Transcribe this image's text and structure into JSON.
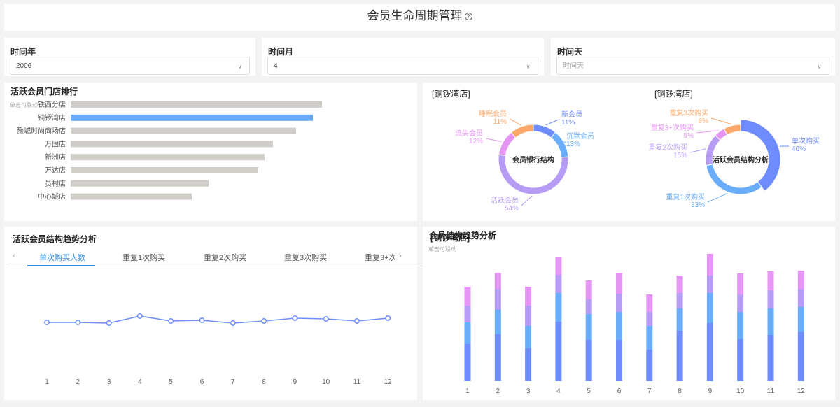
{
  "header": {
    "title": "会员生命周期管理",
    "help_icon": "question-circle-icon"
  },
  "filters": [
    {
      "label": "时间年",
      "value": "2006",
      "placeholder": ""
    },
    {
      "label": "时间月",
      "value": "4",
      "placeholder": ""
    },
    {
      "label": "时间天",
      "value": "",
      "placeholder": "时间天"
    }
  ],
  "store_rank": {
    "title": "活跃会员门店排行",
    "hint": "单击可联动"
  },
  "donut1": {
    "store": "[铜锣湾店]",
    "center": "会员银行结构"
  },
  "donut2": {
    "store": "[铜锣湾店]",
    "center": "活跃会员结构分析"
  },
  "trend": {
    "title": "活跃会员结构趋势分析",
    "tabs": [
      "单次购买人数",
      "重复1次购买",
      "重复2次购买",
      "重复3次购买",
      "重复3+次"
    ],
    "active_tab": 0,
    "prev_icon": "chevron-left-icon",
    "next_icon": "chevron-right-icon"
  },
  "stacked": {
    "title": "会员结构趋势分析",
    "store": "[铜锣湾店]",
    "hint": "单击可联动"
  },
  "colors": {
    "blue": "#6e8cfb",
    "lightblue": "#6aaefb",
    "purple": "#b79cf5",
    "pink": "#e595f4",
    "orange": "#fba86a",
    "gray_bar": "#d1cec9",
    "highlight": "#6aaafb"
  },
  "chart_data": [
    {
      "type": "bar",
      "orientation": "horizontal",
      "categories": [
        "铁西分店",
        "铜锣湾店",
        "豫城时尚商场店",
        "万国店",
        "新洲店",
        "万达店",
        "员村店",
        "中心城店"
      ],
      "values": [
        359,
        346,
        322,
        289,
        277,
        268,
        197,
        173
      ],
      "highlighted": "铜锣湾店"
    },
    {
      "type": "pie",
      "donut": true,
      "slices": [
        {
          "label": "新会员",
          "value": 11
        },
        {
          "label": "沉默会员",
          "value": 13
        },
        {
          "label": "活跃会员",
          "value": 54
        },
        {
          "label": "流失会员",
          "value": 12
        },
        {
          "label": "睡眠会员",
          "value": 11
        }
      ]
    },
    {
      "type": "pie",
      "donut": true,
      "slices": [
        {
          "label": "单次购买",
          "value": 40
        },
        {
          "label": "重复1次购买",
          "value": 33
        },
        {
          "label": "重复2次购买",
          "value": 15
        },
        {
          "label": "重复3+次购买",
          "value": 5
        },
        {
          "label": "重复3次购买",
          "value": 8
        }
      ]
    },
    {
      "type": "line",
      "x": [
        "1",
        "2",
        "3",
        "4",
        "5",
        "6",
        "7",
        "8",
        "9",
        "10",
        "11",
        "12"
      ],
      "values": [
        69,
        69,
        68,
        78,
        71,
        72,
        68,
        71,
        75,
        74,
        71,
        75
      ],
      "ylim": [
        0,
        140
      ]
    },
    {
      "type": "bar",
      "stacked": true,
      "x": [
        "1",
        "2",
        "3",
        "4",
        "5",
        "6",
        "7",
        "8",
        "9",
        "10",
        "11",
        "12"
      ],
      "series": [
        {
          "values": [
            53,
            67,
            47,
            85,
            59,
            59,
            45,
            72,
            83,
            60,
            66,
            70
          ]
        },
        {
          "values": [
            31,
            35,
            32,
            41,
            37,
            40,
            34,
            32,
            43,
            39,
            38,
            36
          ]
        },
        {
          "values": [
            24,
            30,
            29,
            26,
            21,
            26,
            20,
            22,
            25,
            25,
            26,
            26
          ]
        },
        {
          "values": [
            27,
            23,
            27,
            25,
            27,
            30,
            25,
            25,
            31,
            30,
            27,
            26
          ]
        }
      ],
      "ylim": [
        0,
        190
      ]
    }
  ]
}
